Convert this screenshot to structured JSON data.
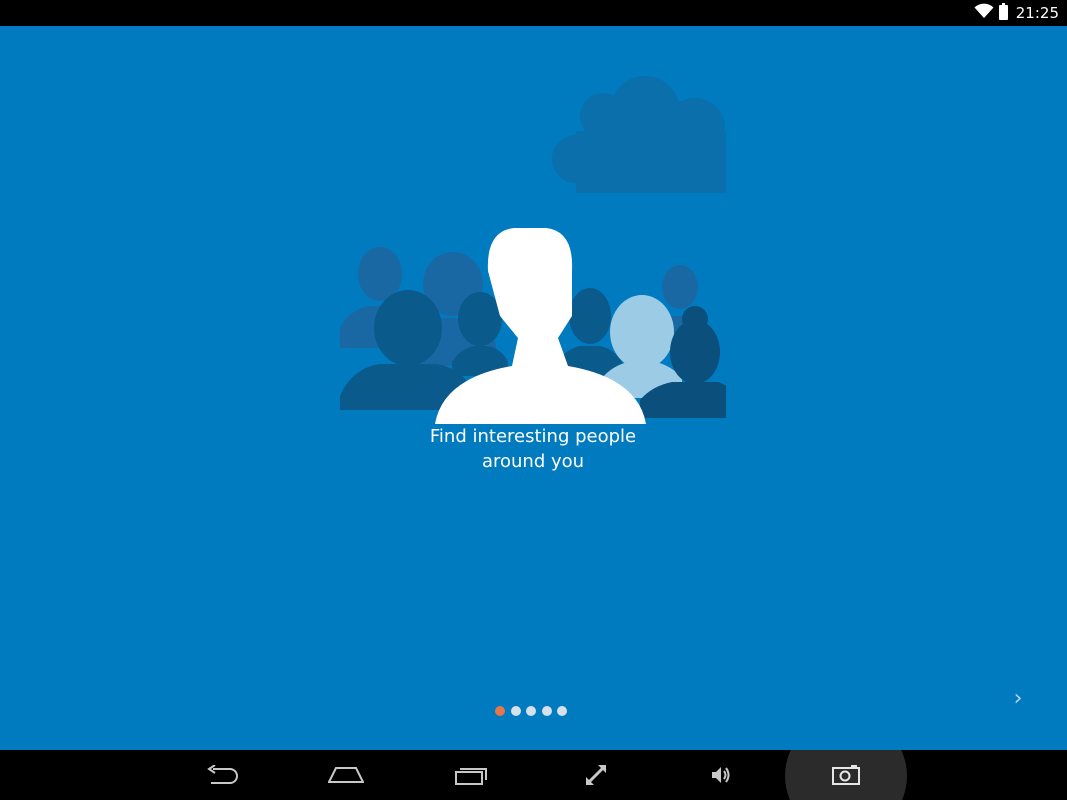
{
  "status_bar": {
    "time": "21:25",
    "icons": [
      "wifi-icon",
      "battery-icon"
    ]
  },
  "onboarding": {
    "caption_line1": "Find interesting people",
    "caption_line2": "around you",
    "pages_total": 5,
    "current_page": 1,
    "next_arrow": "›"
  },
  "nav_bar": {
    "buttons": [
      "back-icon",
      "home-icon",
      "recents-icon",
      "fullscreen-icon",
      "volume-icon",
      "screenshot-camera-icon"
    ]
  },
  "colors": {
    "background_blue": "#007bc0",
    "dot_active": "#e8764a",
    "dot_inactive": "#d6e1ec",
    "silhouette_white": "#ffffff",
    "silhouette_light": "#9ccbe6",
    "silhouette_dark": "#0b4f7c"
  }
}
